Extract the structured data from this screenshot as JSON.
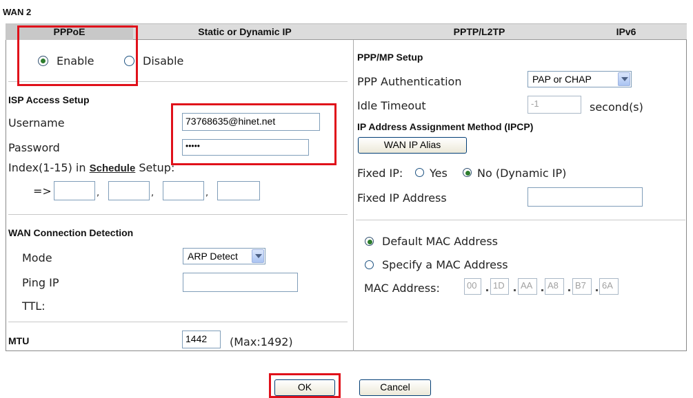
{
  "section_title": "WAN 2",
  "tabs": [
    "PPPoE",
    "Static or Dynamic IP",
    "PPTP/L2TP",
    "IPv6"
  ],
  "enable": {
    "enable_label": "Enable",
    "disable_label": "Disable"
  },
  "isp": {
    "heading": "ISP Access Setup",
    "username_label": "Username",
    "username_value": "73768635@hinet.net",
    "password_label": "Password",
    "password_value": "•••••",
    "index_prefix": "Index(1-15) in ",
    "schedule_link": "Schedule",
    "index_suffix": " Setup:",
    "arrow": "=>",
    "schedule_values": [
      "",
      "",
      "",
      ""
    ],
    "comma": ","
  },
  "wan_detect": {
    "heading": "WAN Connection Detection",
    "mode_label": "Mode",
    "mode_value": "ARP Detect",
    "ping_label": "Ping IP",
    "ping_value": "",
    "ttl_label": "TTL:"
  },
  "mtu": {
    "label": "MTU",
    "value": "1442",
    "max": "(Max:1492)"
  },
  "ppp": {
    "heading": "PPP/MP Setup",
    "auth_label": "PPP Authentication",
    "auth_value": "PAP or CHAP",
    "idle_label": "Idle Timeout",
    "idle_value": "-1",
    "idle_unit": "second(s)"
  },
  "ipcp": {
    "heading": "IP Address Assignment Method (IPCP)",
    "alias_button": "WAN IP Alias",
    "fixed_ip_label": "Fixed IP:",
    "yes_label": "Yes",
    "no_label": "No (Dynamic IP)",
    "fixed_addr_label": "Fixed IP Address",
    "fixed_addr_value": ""
  },
  "mac": {
    "default_label": "Default MAC Address",
    "specify_label": "Specify a MAC Address",
    "address_label": "MAC Address:",
    "octets": [
      "00",
      "1D",
      "AA",
      "A8",
      "B7",
      "6A"
    ]
  },
  "buttons": {
    "ok": "OK",
    "cancel": "Cancel"
  },
  "colors": {
    "highlight": "#e0101a",
    "tab_bar": "#dcdcdc",
    "active_tab": "#c8c8c8"
  }
}
